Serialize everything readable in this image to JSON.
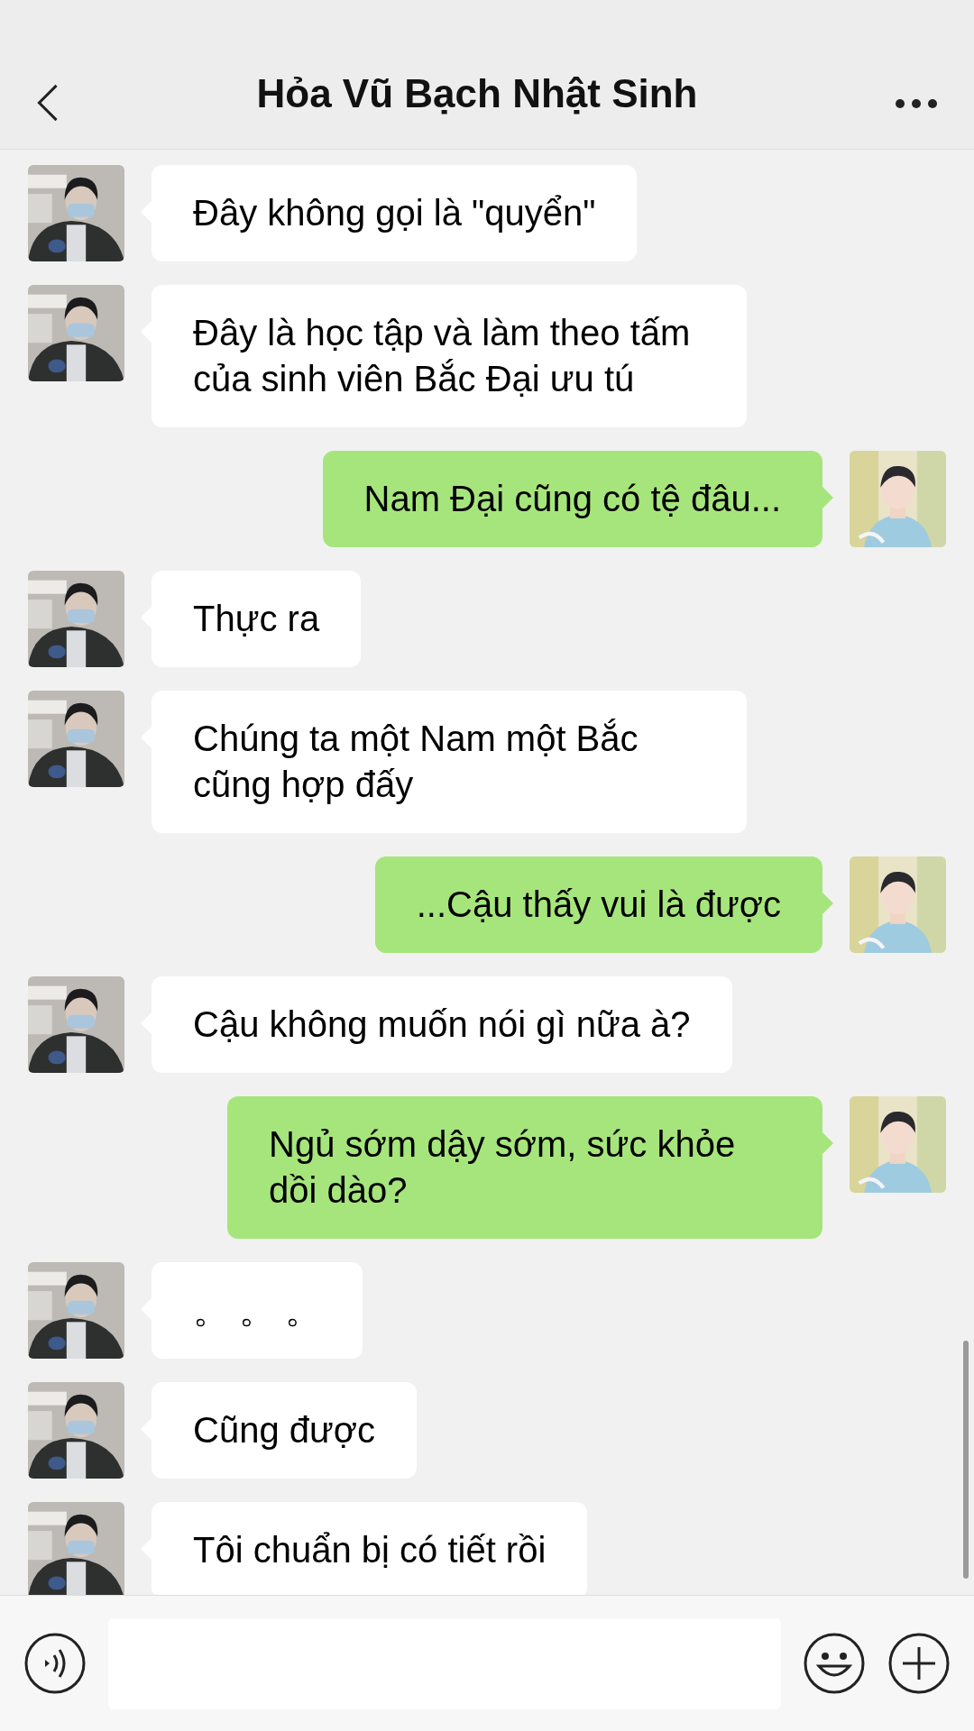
{
  "header": {
    "title": "Hỏa Vũ Bạch Nhật Sinh"
  },
  "messages": [
    {
      "kind": "received",
      "text": "Đây không gọi là \"quyển\""
    },
    {
      "kind": "received",
      "text": "Đây là học tập và làm theo tấm của sinh viên Bắc Đại ưu tú"
    },
    {
      "kind": "sent",
      "text": "Nam Đại cũng có tệ đâu..."
    },
    {
      "kind": "received",
      "text": "Thực ra"
    },
    {
      "kind": "received",
      "text": "Chúng ta một Nam một Bắc cũng hợp đấy"
    },
    {
      "kind": "sent",
      "text": "...Cậu thấy vui là được"
    },
    {
      "kind": "received",
      "text": "Cậu không muốn nói gì nữa à?"
    },
    {
      "kind": "sent",
      "text": "Ngủ sớm dậy sớm, sức khỏe dồi dào?"
    },
    {
      "kind": "received",
      "text": "。 。 。"
    },
    {
      "kind": "received",
      "text": "Cũng được"
    },
    {
      "kind": "received",
      "text": "Tôi chuẩn bị có tiết rồi"
    }
  ]
}
